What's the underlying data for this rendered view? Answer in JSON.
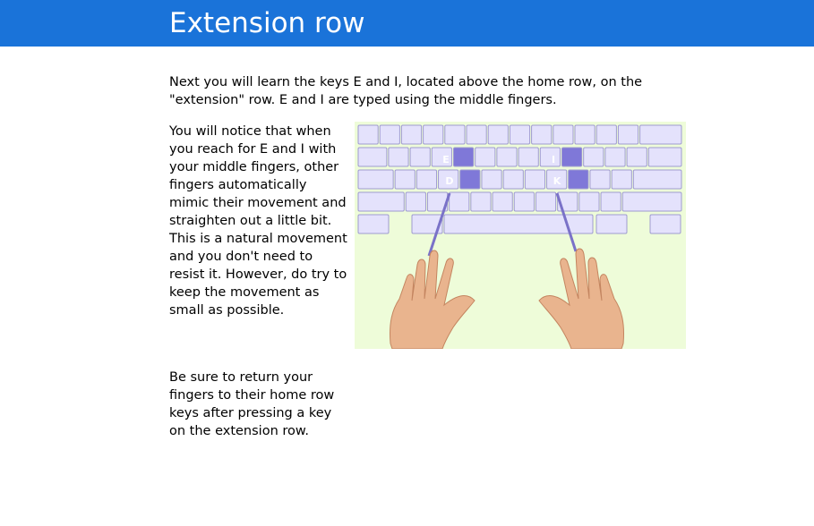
{
  "page": {
    "title": "Extension row",
    "intro": "Next you will learn the keys E and I, located above the home row, on the \"extension\" row. E and I are typed using the middle fingers.",
    "paragraph1": "You will notice that when you reach for E and I with your middle fingers, other fingers automatically mimic their movement and straighten out a little bit. This is a natural movement and you don't need to resist it. However, do try to keep the movement as small as possible.",
    "paragraph2": "Be sure to return your fingers to their home row keys after pressing a key on the extension row."
  },
  "keyboard": {
    "highlighted_keys": [
      "E",
      "I",
      "D",
      "K"
    ]
  },
  "colors": {
    "header_bg": "#1a73d9",
    "illustration_bg": "#eefcd9",
    "key_fill": "#e4e2fc",
    "key_highlight": "#7f78d8",
    "finger_line": "#7a72c8"
  }
}
